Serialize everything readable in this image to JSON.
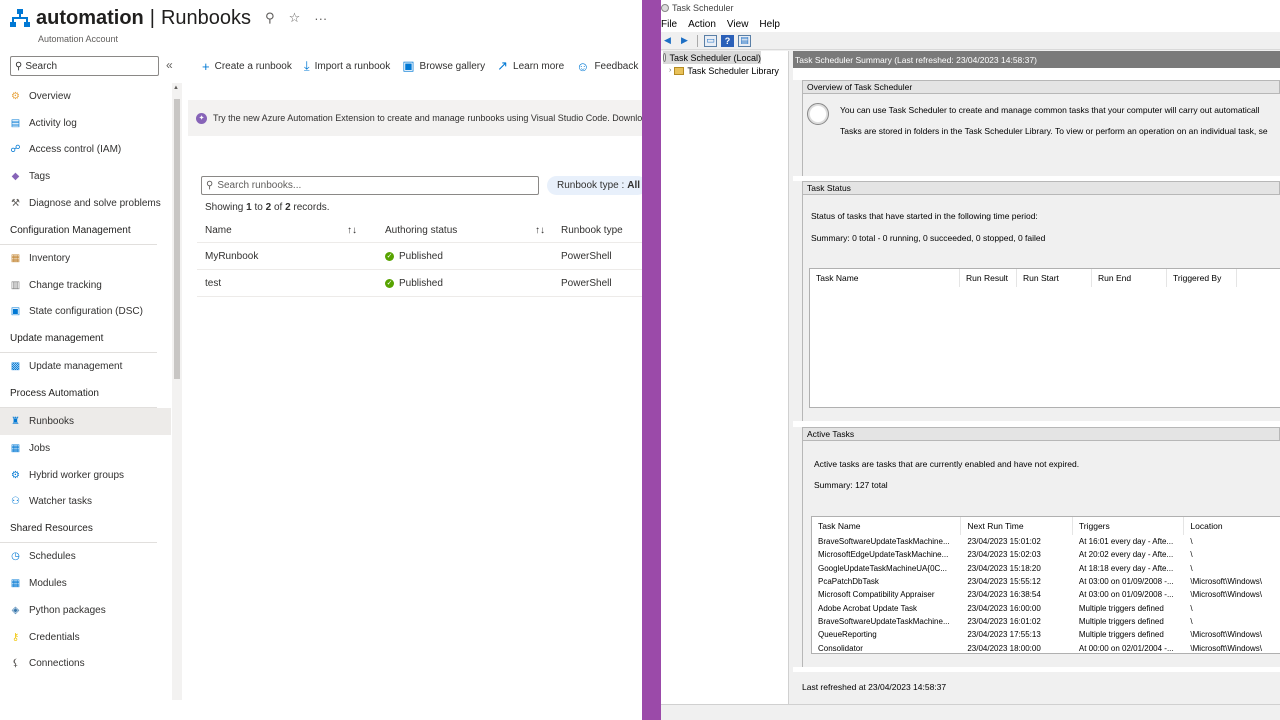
{
  "azure": {
    "title": "automation",
    "title_sep": "|",
    "page": "Runbooks",
    "subtitle": "Automation Account",
    "search_placeholder": "Search",
    "nav": [
      {
        "type": "item",
        "label": "Overview",
        "icon": "overview-icon"
      },
      {
        "type": "item",
        "label": "Activity log",
        "icon": "activity-log-icon"
      },
      {
        "type": "item",
        "label": "Access control (IAM)",
        "icon": "iam-icon"
      },
      {
        "type": "item",
        "label": "Tags",
        "icon": "tag-icon"
      },
      {
        "type": "item",
        "label": "Diagnose and solve problems",
        "icon": "wrench-icon"
      },
      {
        "type": "section",
        "label": "Configuration Management"
      },
      {
        "type": "item",
        "label": "Inventory",
        "icon": "inventory-icon"
      },
      {
        "type": "item",
        "label": "Change tracking",
        "icon": "change-tracking-icon"
      },
      {
        "type": "item",
        "label": "State configuration (DSC)",
        "icon": "dsc-icon"
      },
      {
        "type": "section",
        "label": "Update management"
      },
      {
        "type": "item",
        "label": "Update management",
        "icon": "update-icon"
      },
      {
        "type": "section",
        "label": "Process Automation"
      },
      {
        "type": "item",
        "label": "Runbooks",
        "icon": "runbooks-icon",
        "active": true
      },
      {
        "type": "item",
        "label": "Jobs",
        "icon": "jobs-icon"
      },
      {
        "type": "item",
        "label": "Hybrid worker groups",
        "icon": "hybrid-worker-icon"
      },
      {
        "type": "item",
        "label": "Watcher tasks",
        "icon": "watcher-icon"
      },
      {
        "type": "section",
        "label": "Shared Resources"
      },
      {
        "type": "item",
        "label": "Schedules",
        "icon": "clock-icon"
      },
      {
        "type": "item",
        "label": "Modules",
        "icon": "modules-icon"
      },
      {
        "type": "item",
        "label": "Python packages",
        "icon": "python-icon"
      },
      {
        "type": "item",
        "label": "Credentials",
        "icon": "key-icon"
      },
      {
        "type": "item",
        "label": "Connections",
        "icon": "plug-icon"
      }
    ],
    "toolbar": {
      "create": "Create a runbook",
      "import": "Import a runbook",
      "gallery": "Browse gallery",
      "learn": "Learn more",
      "feedback": "Feedback"
    },
    "banner": "Try the new Azure Automation Extension to create and manage runbooks using Visual Studio Code. Download the e",
    "runbook_search_placeholder": "Search runbooks...",
    "filter_label": "Runbook type :",
    "filter_value": "All",
    "count_text_pre": "Showing ",
    "count_from": "1",
    "count_mid": " to ",
    "count_to": "2",
    "count_of": " of ",
    "count_total": "2",
    "count_post": " records.",
    "columns": {
      "name": "Name",
      "status": "Authoring status",
      "type": "Runbook type"
    },
    "rows": [
      {
        "name": "MyRunbook",
        "status": "Published",
        "type": "PowerShell"
      },
      {
        "name": "test",
        "status": "Published",
        "type": "PowerShell"
      }
    ]
  },
  "ts": {
    "window_title": "Task Scheduler",
    "menu": [
      "File",
      "Action",
      "View",
      "Help"
    ],
    "tree": [
      "Task Scheduler (Local)",
      "Task Scheduler Library"
    ],
    "summary_header": "Task Scheduler Summary (Last refreshed: 23/04/2023 14:58:37)",
    "overview_title": "Overview of Task Scheduler",
    "overview_line1": "You can use Task Scheduler to create and manage common tasks that your computer will carry out automaticall",
    "overview_line2": "Tasks are stored in folders in the Task Scheduler Library. To view or perform an operation on an individual task, se",
    "status_title": "Task Status",
    "status_period": "Status of tasks that have started in the following time period:",
    "status_summary": "Summary: 0 total - 0 running, 0 succeeded, 0 stopped, 0 failed",
    "status_columns": [
      "Task Name",
      "Run Result",
      "Run Start",
      "Run End",
      "Triggered By"
    ],
    "active_title": "Active Tasks",
    "active_desc": "Active tasks are tasks that are currently enabled and have not expired.",
    "active_summary": "Summary: 127 total",
    "active_columns": [
      "Task Name",
      "Next Run Time",
      "Triggers",
      "Location"
    ],
    "active_rows": [
      [
        "BraveSoftwareUpdateTaskMachine...",
        "23/04/2023 15:01:02",
        "At 16:01 every day - Afte...",
        "\\"
      ],
      [
        "MicrosoftEdgeUpdateTaskMachine...",
        "23/04/2023 15:02:03",
        "At 20:02 every day - Afte...",
        "\\"
      ],
      [
        "GoogleUpdateTaskMachineUA{0C...",
        "23/04/2023 15:18:20",
        "At 18:18 every day - Afte...",
        "\\"
      ],
      [
        "PcaPatchDbTask",
        "23/04/2023 15:55:12",
        "At 03:00 on 01/09/2008 -...",
        "\\Microsoft\\Windows\\"
      ],
      [
        "Microsoft Compatibility Appraiser",
        "23/04/2023 16:38:54",
        "At 03:00 on 01/09/2008 -...",
        "\\Microsoft\\Windows\\"
      ],
      [
        "Adobe Acrobat Update Task",
        "23/04/2023 16:00:00",
        "Multiple triggers defined",
        "\\"
      ],
      [
        "BraveSoftwareUpdateTaskMachine...",
        "23/04/2023 16:01:02",
        "Multiple triggers defined",
        "\\"
      ],
      [
        "QueueReporting",
        "23/04/2023 17:55:13",
        "Multiple triggers defined",
        "\\Microsoft\\Windows\\"
      ],
      [
        "Consolidator",
        "23/04/2023 18:00:00",
        "At 00:00 on 02/01/2004 -...",
        "\\Microsoft\\Windows\\"
      ]
    ],
    "footer": "Last refreshed at 23/04/2023 14:58:37"
  }
}
